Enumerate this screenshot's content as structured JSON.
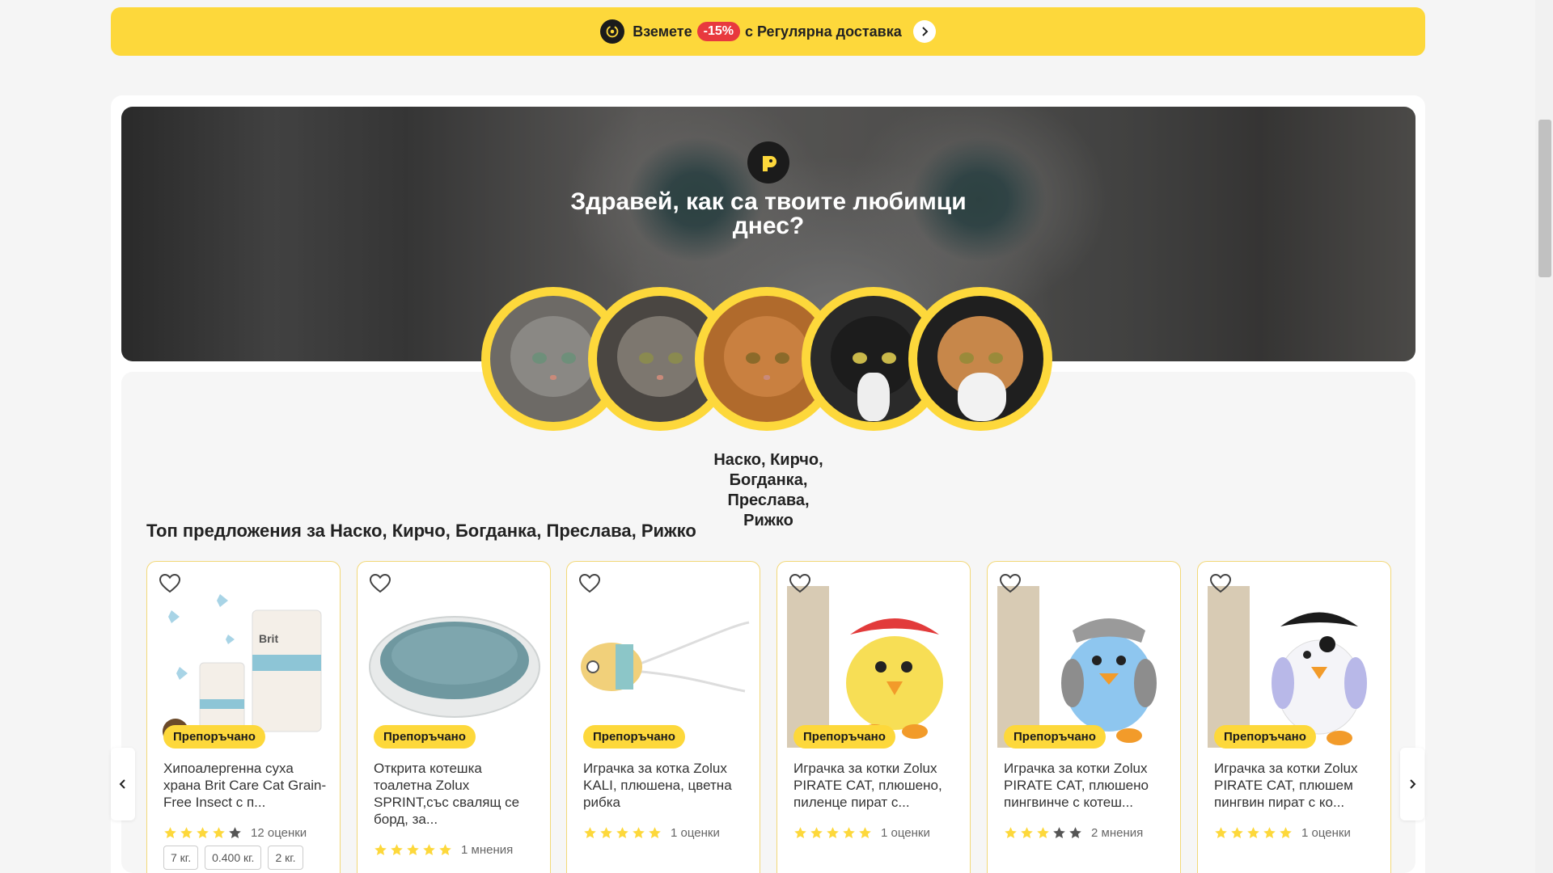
{
  "promo": {
    "prefix": "Вземете",
    "discount": "-15%",
    "suffix": "с Регулярна доставка"
  },
  "hero": {
    "greeting": "Здравей, как са твоите любимци днес?"
  },
  "pets": {
    "names_label": "Наско, Кирчо, Богданка, Преслава, Рижко"
  },
  "offers": {
    "title": "Топ предложения за Наско, Кирчо, Богданка, Преслава, Рижко"
  },
  "products": [
    {
      "badge": "Препоръчано",
      "name": "Хипоалергенна суха храна Brit Care Cat Grain-Free Insect с п...",
      "stars": 4,
      "rating_text": "12 оценки",
      "weights": [
        "7 кг.",
        "0.400 кг.",
        "2 кг."
      ]
    },
    {
      "badge": "Препоръчано",
      "name": "Открита котешка тоалетна Zolux SPRINT,със свалящ се борд, за...",
      "stars": 5,
      "rating_text": "1 мнения",
      "weights": []
    },
    {
      "badge": "Препоръчано",
      "name": "Играчка за котка Zolux KALI, плюшена, цветна рибка",
      "stars": 5,
      "rating_text": "1 оценки",
      "weights": []
    },
    {
      "badge": "Препоръчано",
      "name": "Играчка за котки Zolux PIRATE CAT, плюшено, пиленце пират с...",
      "stars": 5,
      "rating_text": "1 оценки",
      "weights": []
    },
    {
      "badge": "Препоръчано",
      "name": "Играчка за котки Zolux PIRATE CAT, плюшено пингвинче с котеш...",
      "stars": 3,
      "rating_text": "2 мнения",
      "weights": []
    },
    {
      "badge": "Препоръчано",
      "name": "Играчка за котки Zolux PIRATE CAT, плюшем пингвин пират с ко...",
      "stars": 5,
      "rating_text": "1 оценки",
      "weights": []
    }
  ],
  "colors": {
    "brand_yellow": "#fdd83b",
    "discount_red": "#e8393e",
    "star_yellow": "#fdd83b",
    "star_grey": "#555555"
  },
  "icons": {
    "promo": "delivery-cycle-icon",
    "promo_arrow": "chevron-right-icon",
    "logo": "brand-logo-icon",
    "favorite": "heart-outline-icon",
    "carousel_prev": "chevron-left-icon",
    "carousel_next": "chevron-right-icon"
  }
}
